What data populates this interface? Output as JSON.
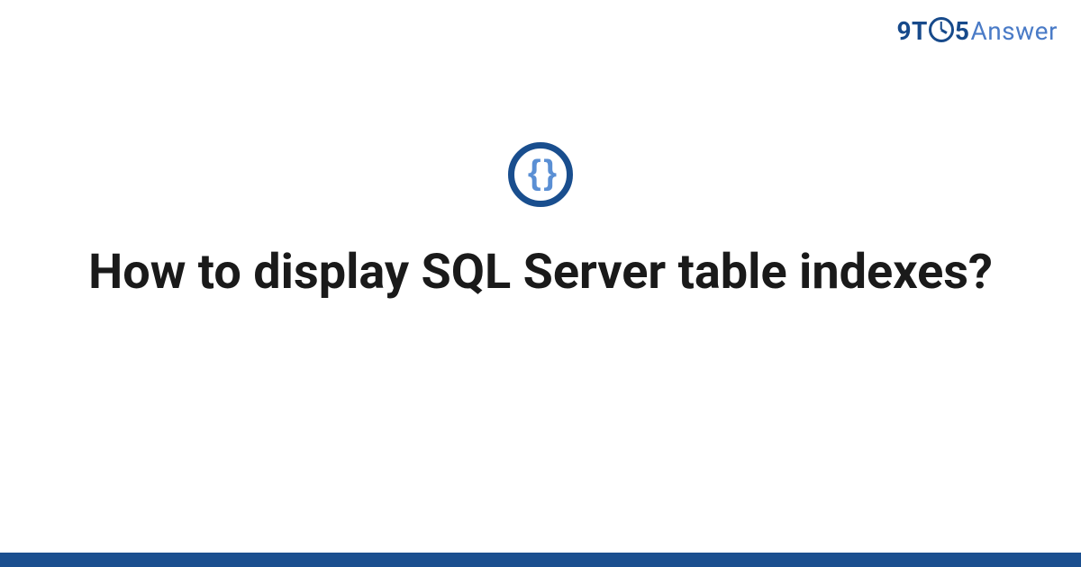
{
  "brand": {
    "part1": "9T",
    "part2": "5",
    "part3": "Answer"
  },
  "icon": {
    "name": "code-braces-icon",
    "glyph": "{ }"
  },
  "title": "How to display SQL Server table indexes?",
  "colors": {
    "brand_dark": "#174a8b",
    "brand_light": "#4a7bc7",
    "bar": "#1b4f8f"
  }
}
